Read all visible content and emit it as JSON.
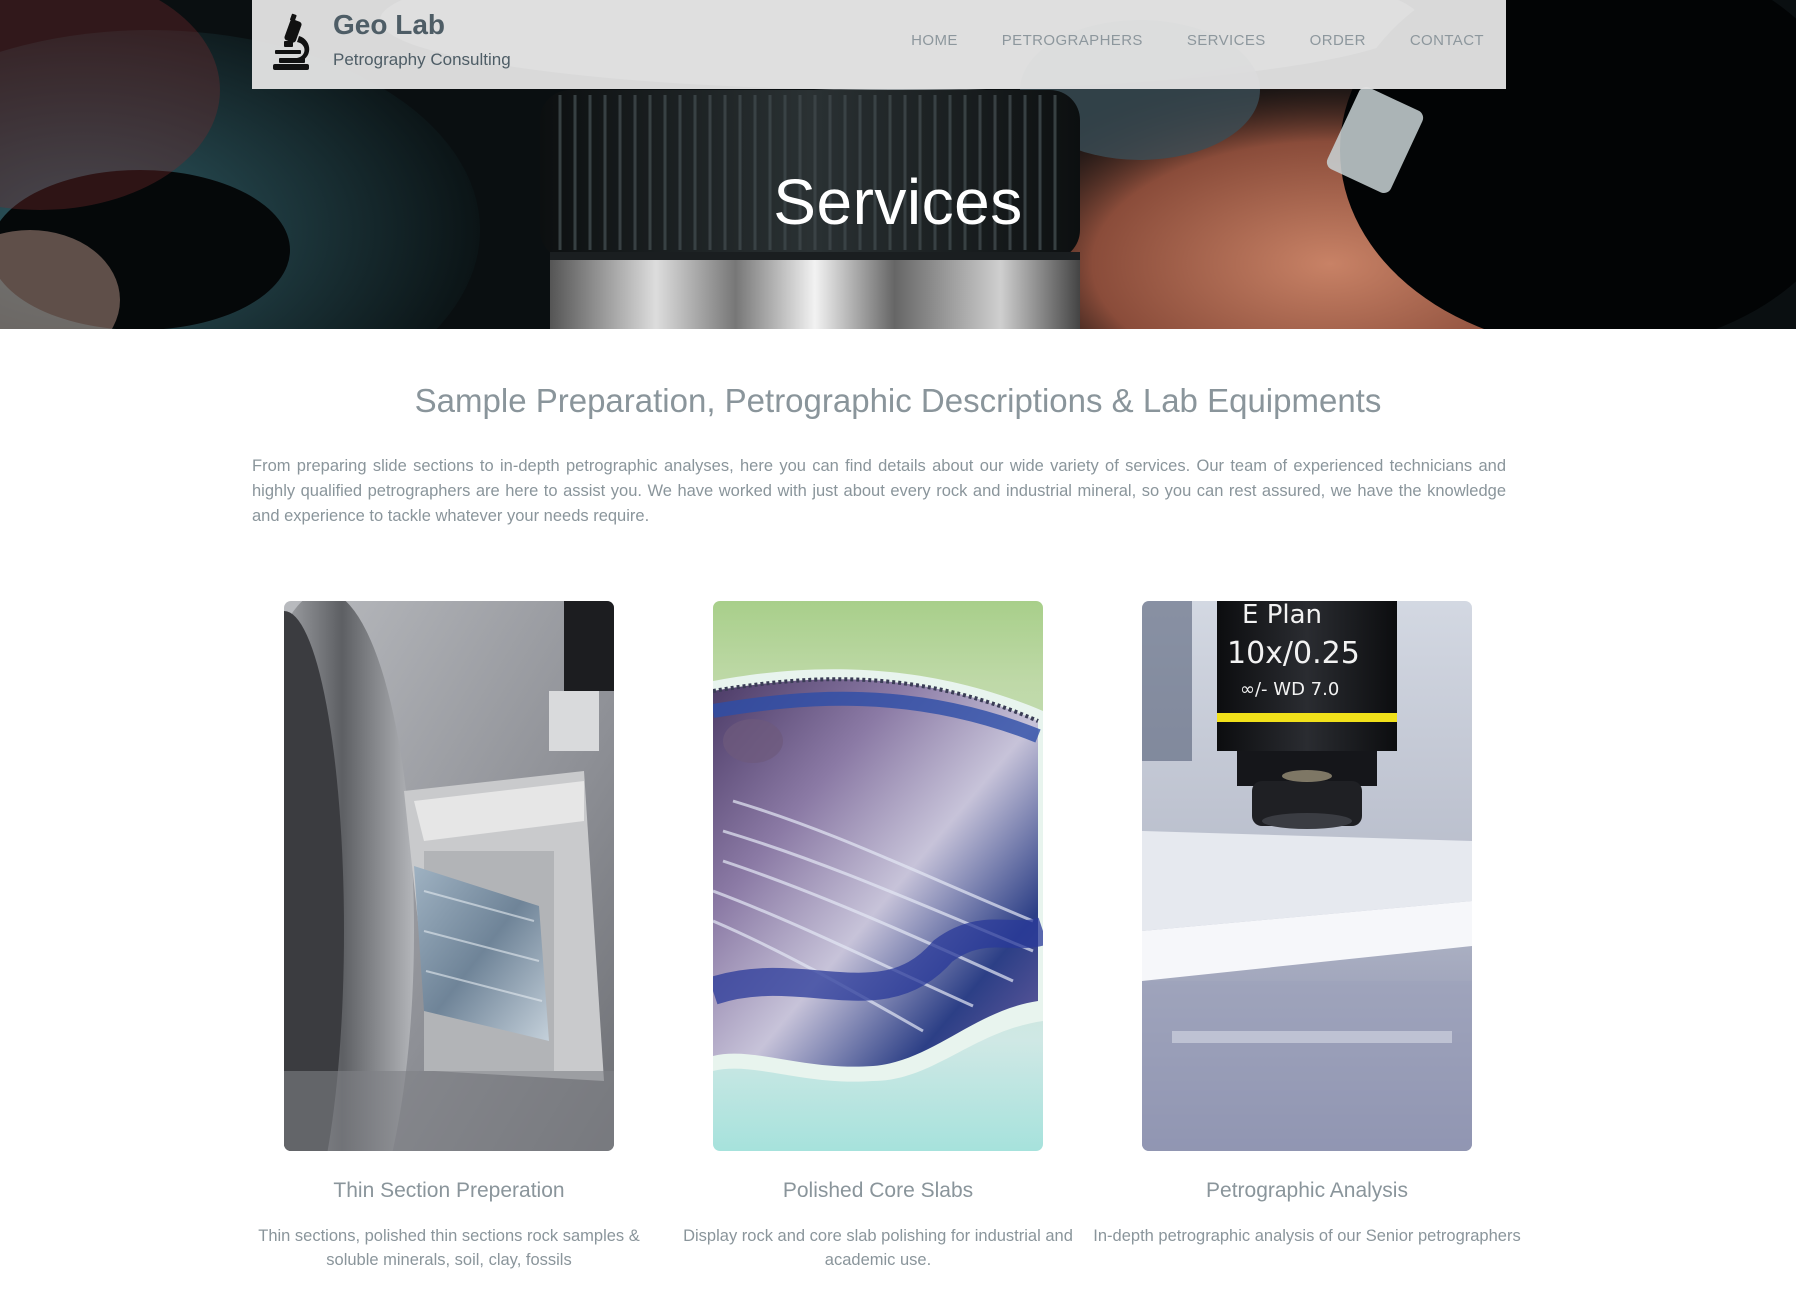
{
  "header": {
    "brand_title": "Geo Lab",
    "brand_subtitle": "Petrography Consulting",
    "logo_icon": "microscope-icon",
    "nav": [
      {
        "label": "HOME"
      },
      {
        "label": "PETROGRAPHERS"
      },
      {
        "label": "SERVICES"
      },
      {
        "label": "ORDER"
      },
      {
        "label": "CONTACT"
      }
    ]
  },
  "hero": {
    "title": "Services"
  },
  "intro": {
    "heading": "Sample Preparation, Petrographic Descriptions & Lab Equipments",
    "paragraph": "From preparing slide sections to in-depth petrographic analyses, here you can find details about our wide variety of services. Our team of experienced technicians and highly qualified petrographers are here to assist you. We have worked with just about every rock and industrial mineral, so you can rest assured, we have the knowledge and experience to tackle whatever your needs require."
  },
  "services": [
    {
      "title": "Thin Section Preperation",
      "description": "Thin sections, polished thin sections rock samples & soluble minerals, soil, clay, fossils"
    },
    {
      "title": "Polished Core Slabs",
      "description": "Display rock and core slab polishing for industrial and academic use."
    },
    {
      "title": "Petrographic Analysis",
      "description": "In-depth petrographic analysis of our Senior petrographers",
      "photo_text": [
        "E Plan",
        "10x/0.25",
        "∞/-  WD  7.0"
      ]
    }
  ],
  "colors": {
    "header_bg": "#e2e2e2",
    "brand_text": "#4e5d66",
    "body_text": "#8a959b",
    "hero_title": "#ffffff"
  }
}
